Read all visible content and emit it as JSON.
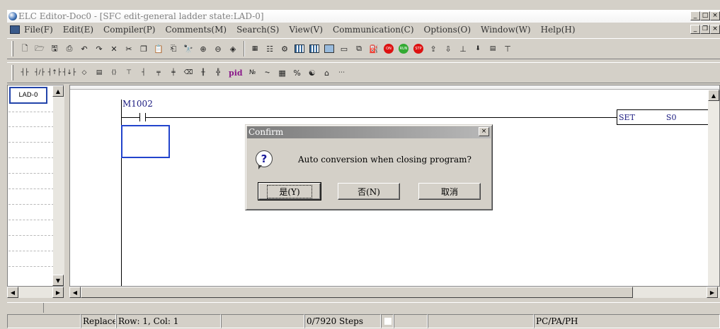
{
  "window": {
    "title": "ELC Editor-Doc0 - [SFC edit-general ladder state:LAD-0]"
  },
  "menu": [
    {
      "label": "File(F)"
    },
    {
      "label": "Edit(E)"
    },
    {
      "label": "Compiler(P)"
    },
    {
      "label": "Comments(M)"
    },
    {
      "label": "Search(S)"
    },
    {
      "label": "View(V)"
    },
    {
      "label": "Communication(C)"
    },
    {
      "label": "Options(O)"
    },
    {
      "label": "Window(W)"
    },
    {
      "label": "Help(H)"
    }
  ],
  "toolbar2": {
    "pid_label": "pid"
  },
  "sfc": {
    "state_label": "LAD-0"
  },
  "ladder": {
    "contact_label": "M1002",
    "instruction": "SET",
    "operand": "S0"
  },
  "dialog": {
    "title": "Confirm",
    "message": "Auto conversion when closing program?",
    "yes_label": "是(Y)",
    "no_label": "否(N)",
    "cancel_label": "取消"
  },
  "status": {
    "mode": "Replace",
    "position": "Row: 1, Col: 1",
    "steps": "0/7920 Steps",
    "model": "PC/PA/PH"
  }
}
